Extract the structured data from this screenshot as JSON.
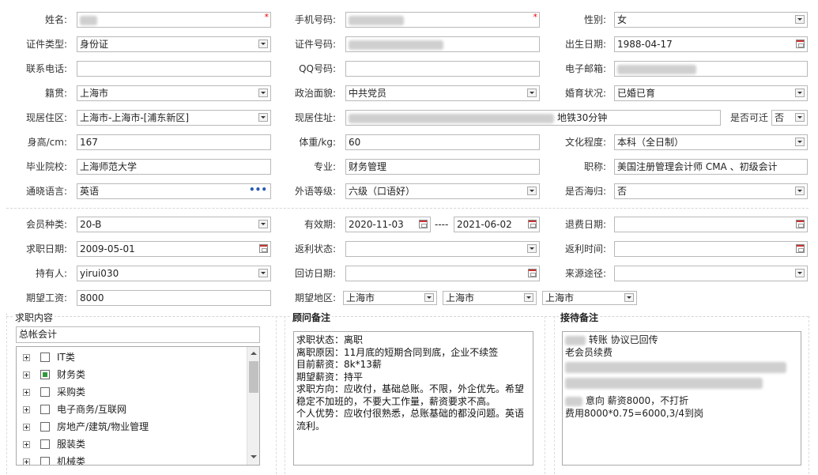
{
  "required_mark": "*",
  "personal": {
    "name_label": "姓名:",
    "phone_label": "手机号码:",
    "gender_label": "性别:",
    "gender_value": "女",
    "id_type_label": "证件类型:",
    "id_type_value": "身份证",
    "id_no_label": "证件号码:",
    "birth_label": "出生日期:",
    "birth_value": "1988-04-17",
    "contact_phone_label": "联系电话:",
    "qq_label": "QQ号码:",
    "email_label": "电子邮箱:",
    "native_label": "籍贯:",
    "native_value": "上海市",
    "political_label": "政治面貌:",
    "political_value": "中共党员",
    "marital_label": "婚育状况:",
    "marital_value": "已婚已育",
    "residence_label": "现居住区:",
    "residence_value": "上海市-上海市-[浦东新区]",
    "address_label": "现居住址:",
    "address_suffix": "地铁30分钟",
    "relocate_label": "是否可迁",
    "relocate_value": "否",
    "height_label": "身高/cm:",
    "height_value": "167",
    "weight_label": "体重/kg:",
    "weight_value": "60",
    "education_label": "文化程度:",
    "education_value": "本科（全日制）",
    "school_label": "毕业院校:",
    "school_value": "上海师范大学",
    "major_label": "专业:",
    "major_value": "财务管理",
    "title_label": "职称:",
    "title_value": "美国注册管理会计师 CMA 、初级会计",
    "language_label": "通晓语言:",
    "language_value": "英语",
    "language_more": "•••",
    "lang_level_label": "外语等级:",
    "lang_level_value": "六级（口语好）",
    "overseas_label": "是否海归:",
    "overseas_value": "否"
  },
  "membership": {
    "member_type_label": "会员种类:",
    "member_type_value": "20-B",
    "valid_label": "有效期:",
    "valid_from": "2020-11-03",
    "valid_sep": "----",
    "valid_to": "2021-06-02",
    "refund_date_label": "退费日期:",
    "apply_date_label": "求职日期:",
    "apply_date_value": "2009-05-01",
    "rebate_status_label": "返利状态:",
    "rebate_time_label": "返利时间:",
    "holder_label": "持有人:",
    "holder_value": "yirui030",
    "revisit_label": "回访日期:",
    "source_label": "来源途径:",
    "salary_label": "期望工资:",
    "salary_value": "8000",
    "region_label": "期望地区:",
    "region_values": [
      "上海市",
      "上海市",
      "上海市"
    ]
  },
  "job_panel": {
    "title": "求职内容",
    "selected": "总帐会计",
    "tree": [
      {
        "label": "IT类",
        "state": "none"
      },
      {
        "label": "财务类",
        "state": "partial"
      },
      {
        "label": "采购类",
        "state": "none"
      },
      {
        "label": "电子商务/互联网",
        "state": "none"
      },
      {
        "label": "房地产/建筑/物业管理",
        "state": "none"
      },
      {
        "label": "服装类",
        "state": "none"
      },
      {
        "label": "机械类",
        "state": "none"
      }
    ]
  },
  "advisor_panel": {
    "title": "顾问备注",
    "text": "求职状态：离职\n离职原因：11月底的短期合同到底，企业不续签\n目前薪资：8k*13薪\n期望薪资：持平\n求职方向：应收付，基础总账。不限，外企优先。希望稳定不加班的，不要大工作量，薪资要求不高。\n个人优势：应收付很熟悉，总账基础的都没问题。英语流利。"
  },
  "reception_panel": {
    "title": "接待备注",
    "line1": "转账 协议已回传",
    "line2": "老会员续费",
    "line3": "意向 薪资8000，不打折",
    "line4": "费用8000*0.75=6000,3/4到岗"
  }
}
